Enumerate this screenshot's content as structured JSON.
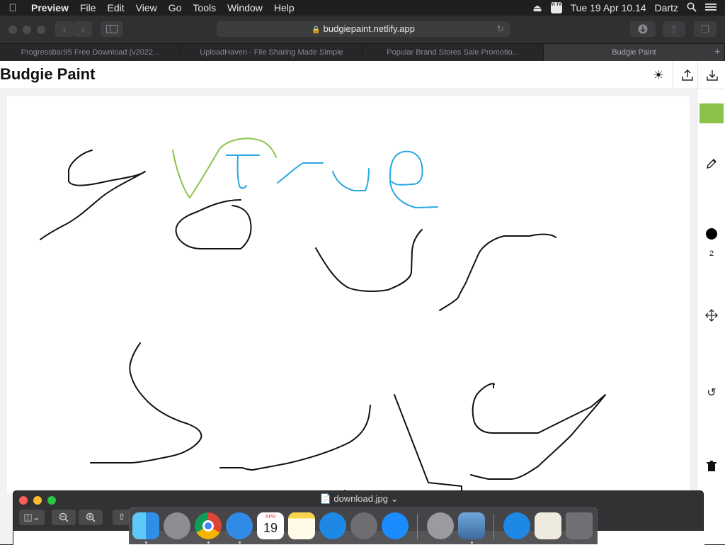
{
  "menubar": {
    "app_name": "Preview",
    "menus": [
      "File",
      "Edit",
      "View",
      "Go",
      "Tools",
      "Window",
      "Help"
    ],
    "input_badge": "VI TX",
    "datetime": "Tue 19 Apr  10.14",
    "user": "Dartz"
  },
  "browser": {
    "url": "budgiepaint.netlify.app",
    "tabs": [
      {
        "label": "Progressbar95 Free Download (v2022..."
      },
      {
        "label": "UploadHaven - File Sharing Made Simple"
      },
      {
        "label": "Popular Brand Stores Sale Promotio..."
      },
      {
        "label": "Budgie Paint"
      }
    ],
    "new_tab": "+"
  },
  "app": {
    "title": "Budgie Paint",
    "brush_color": "#8bc34a",
    "brush_size": "2"
  },
  "preview_window": {
    "title": "download.jpg ⌄"
  },
  "dock": {
    "calendar_month": "APR",
    "calendar_day": "19"
  }
}
